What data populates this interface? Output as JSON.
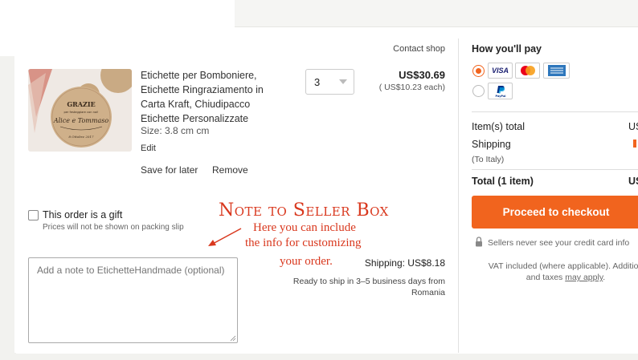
{
  "cart": {
    "contact_shop": "Contact shop",
    "item": {
      "title": "Etichette per Bomboniere, Etichette Ringraziamento in Carta Kraft, Chiudipacco Etichette Personalizzate",
      "size": "Size: 3.8 cm cm",
      "edit": "Edit",
      "save_for_later": "Save for later",
      "remove": "Remove",
      "quantity": "3",
      "price": "US$30.69",
      "each": "( US$10.23 each)",
      "thumb_text": {
        "grazie": "GRAZIE",
        "sub": "per festeggiare con noi!",
        "names": "Alice e Tommaso",
        "date": "8 Ottobre 2017"
      }
    },
    "gift": {
      "label": "This order is a gift",
      "note": "Prices will not be shown on packing slip"
    },
    "note_placeholder": "Add a note to EtichetteHandmade (optional)",
    "shipping": "Shipping: US$8.18",
    "ship_time": "Ready to ship in 3–5 business days from Romania"
  },
  "annotation": {
    "title": "Note to Seller Box",
    "line1": "Here you can include",
    "line2": "the info for customizing",
    "line3": "your order.",
    "color": "#d9381e"
  },
  "payment": {
    "title": "How you'll pay",
    "cards": [
      "VISA",
      "mastercard",
      "AMEX"
    ],
    "paypal": "PayPal",
    "item_total_label": "Item(s) total",
    "item_total_value": "US",
    "shipping_label": "Shipping",
    "shipping_sub": "(To Italy)",
    "total_label": "Total (1 item)",
    "total_value": "US",
    "checkout": "Proceed to checkout",
    "secure_note": "Sellers never see your credit card info",
    "vat_line1": "VAT included (where applicable). Addition",
    "vat_line2_prefix": "and taxes ",
    "vat_link": "may apply",
    "vat_line2_suffix": ".",
    "accent": "#f1641e"
  }
}
